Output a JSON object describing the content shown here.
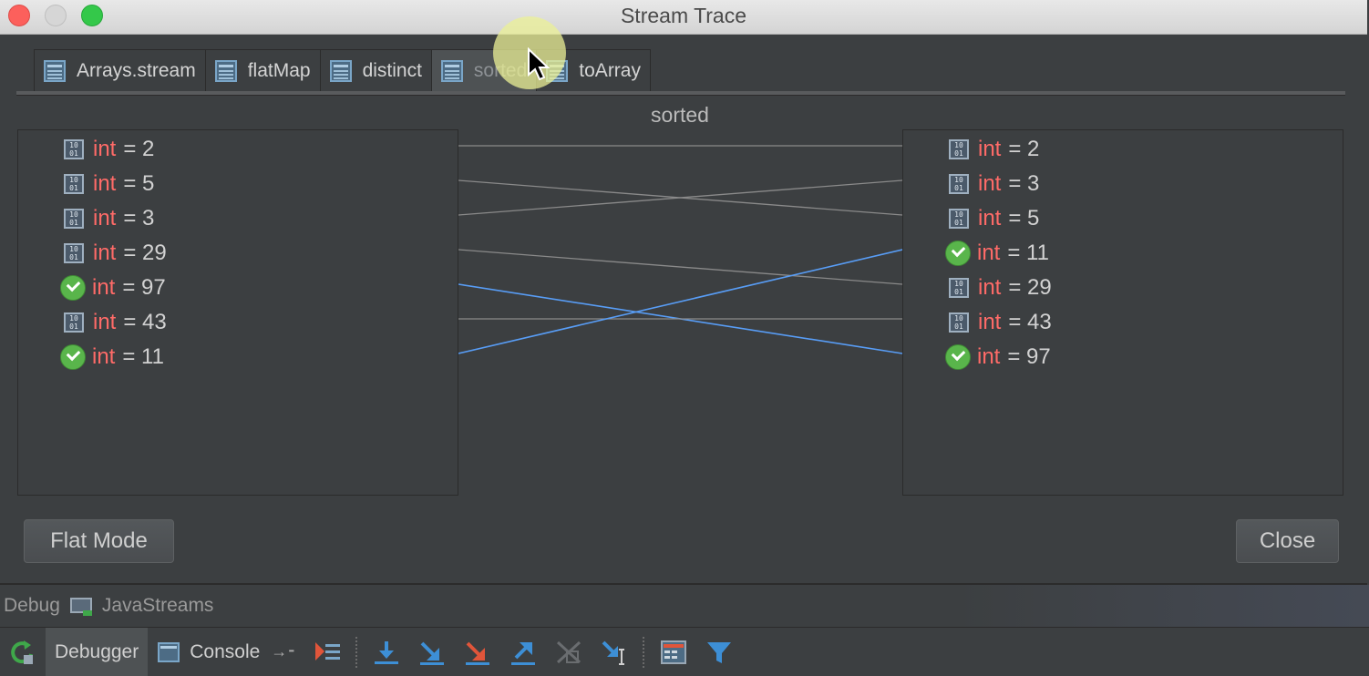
{
  "window": {
    "title": "Stream Trace"
  },
  "tabs": [
    {
      "label": "Arrays.stream",
      "active": false
    },
    {
      "label": "flatMap",
      "active": false
    },
    {
      "label": "distinct",
      "active": false
    },
    {
      "label": "sorted",
      "active": true
    },
    {
      "label": "toArray",
      "active": false
    }
  ],
  "section_title": "sorted",
  "left_items": [
    {
      "type": "int",
      "value": "= 2",
      "icon": "binary-icon"
    },
    {
      "type": "int",
      "value": "= 5",
      "icon": "binary-icon"
    },
    {
      "type": "int",
      "value": "= 3",
      "icon": "binary-icon"
    },
    {
      "type": "int",
      "value": "= 29",
      "icon": "binary-icon"
    },
    {
      "type": "int",
      "value": "= 97",
      "icon": "check-icon"
    },
    {
      "type": "int",
      "value": "= 43",
      "icon": "binary-icon"
    },
    {
      "type": "int",
      "value": "= 11",
      "icon": "check-icon"
    }
  ],
  "right_items": [
    {
      "type": "int",
      "value": "= 2",
      "icon": "binary-icon"
    },
    {
      "type": "int",
      "value": "= 3",
      "icon": "binary-icon"
    },
    {
      "type": "int",
      "value": "= 5",
      "icon": "binary-icon"
    },
    {
      "type": "int",
      "value": "= 11",
      "icon": "check-icon"
    },
    {
      "type": "int",
      "value": "= 29",
      "icon": "binary-icon"
    },
    {
      "type": "int",
      "value": "= 43",
      "icon": "binary-icon"
    },
    {
      "type": "int",
      "value": "= 97",
      "icon": "check-icon"
    }
  ],
  "mappings": [
    {
      "from": 0,
      "to": 0,
      "highlight": false
    },
    {
      "from": 1,
      "to": 2,
      "highlight": false
    },
    {
      "from": 2,
      "to": 1,
      "highlight": false
    },
    {
      "from": 3,
      "to": 4,
      "highlight": false
    },
    {
      "from": 4,
      "to": 6,
      "highlight": true
    },
    {
      "from": 5,
      "to": 5,
      "highlight": false
    },
    {
      "from": 6,
      "to": 3,
      "highlight": true
    }
  ],
  "colors": {
    "link": "#8a8a8a",
    "link_highlight": "#589df6"
  },
  "buttons": {
    "flat_mode": "Flat Mode",
    "close": "Close"
  },
  "debug": {
    "label": "Debug",
    "config": "JavaStreams"
  },
  "toolbar": {
    "debugger": "Debugger",
    "console": "Console"
  }
}
